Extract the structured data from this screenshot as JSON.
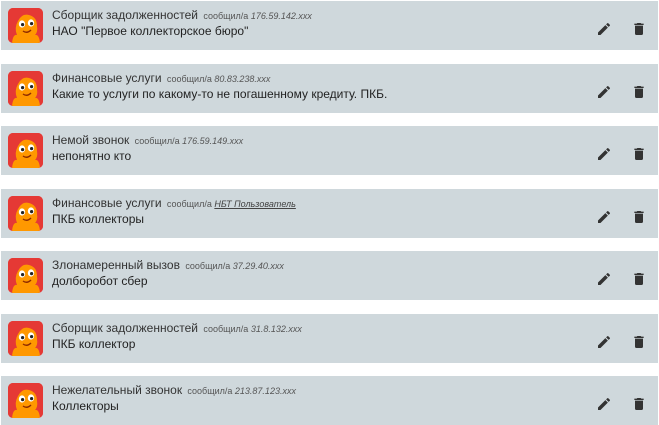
{
  "colors": {
    "row_background": "#cfd8dc",
    "avatar_background": "#e53935",
    "avatar_face": "#ff9800",
    "icon_color": "#333333"
  },
  "icons": {
    "edit": "pencil-icon",
    "delete": "trash-icon",
    "avatar": "octopus-avatar"
  },
  "entries": [
    {
      "category": "Сборщик задолженностей",
      "verb": "сообщил/а",
      "source": "176.59.142.xxx",
      "source_type": "ip",
      "comment": "НАО \"Первое коллекторское бюро\""
    },
    {
      "category": "Финансовые услуги",
      "verb": "сообщил/а",
      "source": "80.83.238.xxx",
      "source_type": "ip",
      "comment": "Какие то услуги по какому-то не погашенному кредиту. ПКБ."
    },
    {
      "category": "Немой звонок",
      "verb": "сообщил/а",
      "source": "176.59.149.xxx",
      "source_type": "ip",
      "comment": "непонятно кто"
    },
    {
      "category": "Финансовые услуги",
      "verb": "сообщил/а",
      "source": "НБТ Пользователь",
      "source_type": "user",
      "comment": "ПКБ коллекторы"
    },
    {
      "category": "Злонамеренный вызов",
      "verb": "сообщил/а",
      "source": "37.29.40.xxx",
      "source_type": "ip",
      "comment": "долборобот сбер"
    },
    {
      "category": "Сборщик задолженностей",
      "verb": "сообщил/а",
      "source": "31.8.132.xxx",
      "source_type": "ip",
      "comment": "ПКБ коллектор"
    },
    {
      "category": "Нежелательный звонок",
      "verb": "сообщил/а",
      "source": "213.87.123.xxx",
      "source_type": "ip",
      "comment": "Коллекторы"
    }
  ]
}
